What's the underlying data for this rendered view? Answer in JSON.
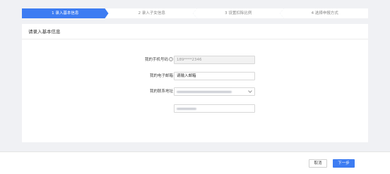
{
  "steps": [
    {
      "label": "1 录入基本信息",
      "active": true
    },
    {
      "label": "2 录入子女信息",
      "active": false
    },
    {
      "label": "3 设置扣除比例",
      "active": false
    },
    {
      "label": "4 选择申报方式",
      "active": false
    }
  ],
  "card": {
    "title": "请录入基本信息"
  },
  "form": {
    "phone_label": "我的手机号码",
    "phone_value": "189****2346",
    "email_label": "我的电子邮箱",
    "email_placeholder": "请输入邮箱",
    "address_label": "我的联系地址"
  },
  "footer": {
    "cancel_label": "取消",
    "next_label": "下一步"
  },
  "colors": {
    "primary": "#3d7cf2",
    "background": "#f0f1f4"
  },
  "icons": {
    "help": "help-circle-icon",
    "dropdown": "chevron-down-icon"
  }
}
